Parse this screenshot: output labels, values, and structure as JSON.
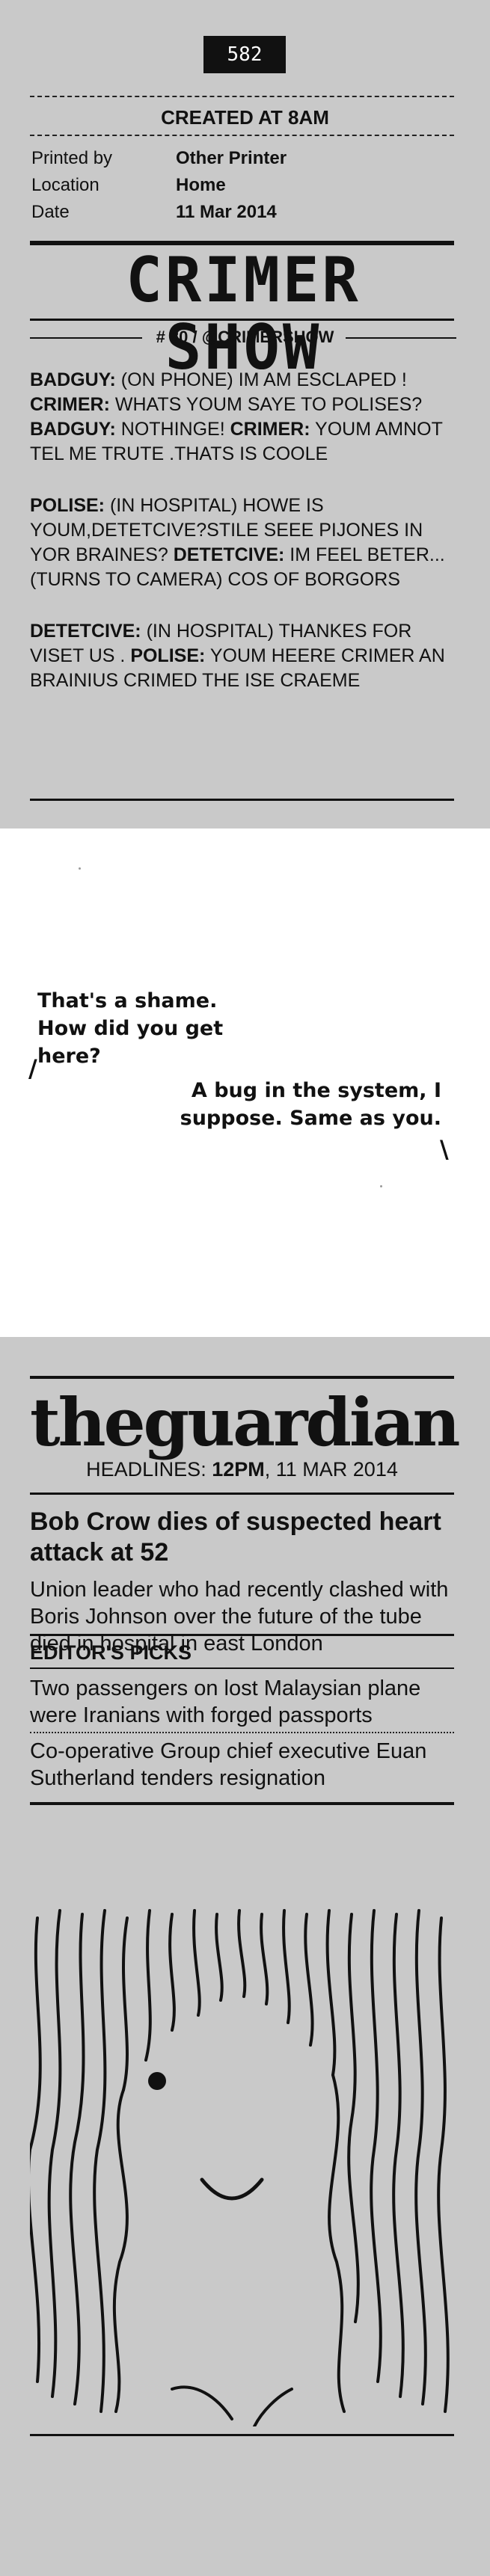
{
  "receipt": {
    "number": "582",
    "created": "CREATED AT 8AM",
    "meta": [
      {
        "label": "Printed by",
        "value": "Other Printer"
      },
      {
        "label": "Location",
        "value": "Home"
      },
      {
        "label": "Date",
        "value": "11 Mar 2014"
      }
    ],
    "show_title": "CRIMER SHOW",
    "tag": "# 80 / @CRIMERSHOW",
    "dialogue": [
      [
        {
          "speaker": "BADGUY:",
          "line": " (ON PHONE) IM AM ESCLAPED ! "
        },
        {
          "speaker": "CRIMER:",
          "line": " WHATS YOUM SAYE TO POLISES? "
        },
        {
          "speaker": "BADGUY:",
          "line": " NOTHINGE! "
        },
        {
          "speaker": "CRIMER:",
          "line": " YOUM AMNOT TEL ME TRUTE .THATS IS COOLE"
        }
      ],
      [
        {
          "speaker": "POLISE:",
          "line": " (IN HOSPITAL) HOWE IS YOUM,DETETCIVE?STILE SEEE PIJONES IN YOR BRAINES? "
        },
        {
          "speaker": "DETETCIVE:",
          "line": " IM FEEL BETER... (TURNS TO CAMERA) COS OF BORGORS"
        }
      ],
      [
        {
          "speaker": "DETETCIVE:",
          "line": " (IN HOSPITAL) THANKES FOR VISET US . "
        },
        {
          "speaker": "POLISE:",
          "line": " YOUM HEERE CRIMER AN BRAINIUS CRIMED THE ISE CRAEME"
        }
      ]
    ]
  },
  "conversation": {
    "line1": "That's a shame. How did you get here?",
    "line2": "A bug in the system, I suppose. Same as you."
  },
  "guardian": {
    "logo": "theguardian",
    "headlines_label": "HEADLINES: ",
    "headlines_time": "12PM",
    "headlines_date": ", 11 MAR 2014",
    "lead_title": "Bob Crow dies of suspected heart attack at 52",
    "lead_sub": "Union leader who had recently clashed with Boris Johnson over the future of the tube died in hospital in east London",
    "picks_label": "EDITOR'S PICKS",
    "picks": [
      "Two passengers on lost Malaysian plane were Iranians with forged passports",
      "Co-operative Group chief executive Euan Sutherland tenders resignation"
    ]
  }
}
